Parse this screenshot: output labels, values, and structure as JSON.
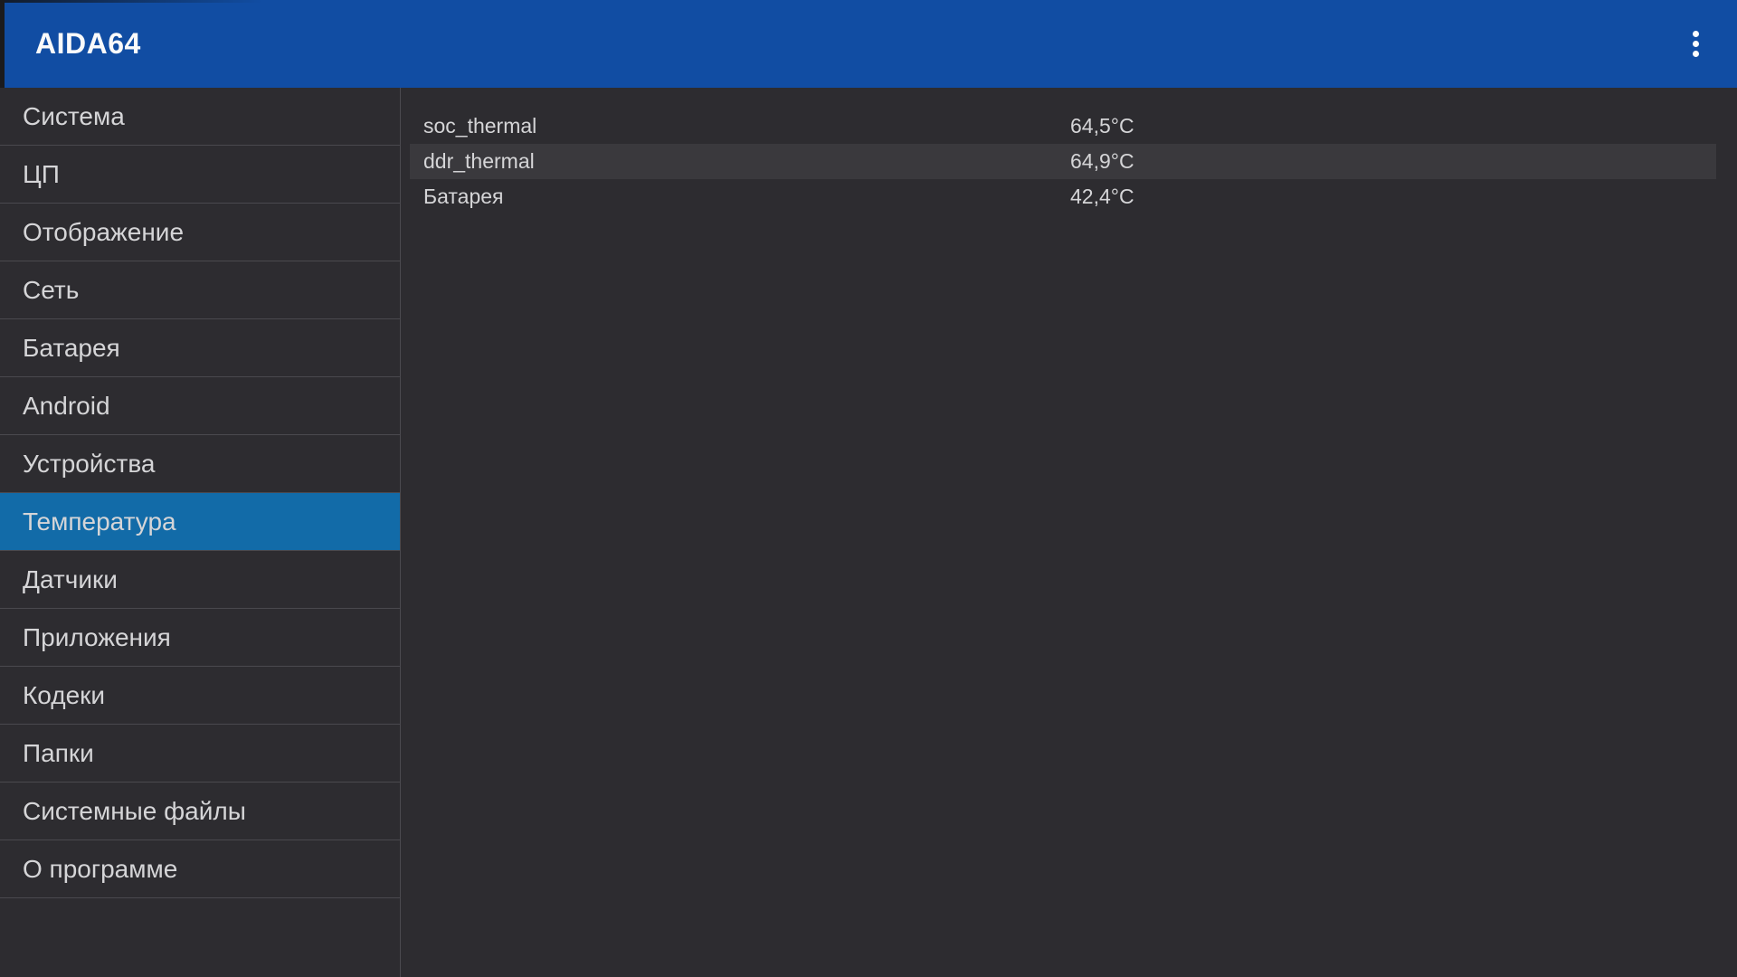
{
  "colors": {
    "header_bg": "#114da3",
    "selected_bg": "#126ba8",
    "bg": "#2d2c30",
    "highlight_bg": "#3a393d",
    "divider": "#4a494e",
    "text": "#d5d5d7",
    "title_text": "#fafafa"
  },
  "header": {
    "title": "AIDA64",
    "overflow_icon": "overflow-menu-icon"
  },
  "sidebar": {
    "items": [
      {
        "label": "Система",
        "selected": false
      },
      {
        "label": "ЦП",
        "selected": false
      },
      {
        "label": "Отображение",
        "selected": false
      },
      {
        "label": "Сеть",
        "selected": false
      },
      {
        "label": "Батарея",
        "selected": false
      },
      {
        "label": "Android",
        "selected": false
      },
      {
        "label": "Устройства",
        "selected": false
      },
      {
        "label": "Температура",
        "selected": true
      },
      {
        "label": "Датчики",
        "selected": false
      },
      {
        "label": "Приложения",
        "selected": false
      },
      {
        "label": "Кодеки",
        "selected": false
      },
      {
        "label": "Папки",
        "selected": false
      },
      {
        "label": "Системные файлы",
        "selected": false
      },
      {
        "label": "О программе",
        "selected": false
      }
    ]
  },
  "content": {
    "rows": [
      {
        "name": "soc_thermal",
        "value": "64,5°C",
        "highlighted": false
      },
      {
        "name": "ddr_thermal",
        "value": "64,9°C",
        "highlighted": true
      },
      {
        "name": "Батарея",
        "value": "42,4°C",
        "highlighted": false
      }
    ]
  }
}
